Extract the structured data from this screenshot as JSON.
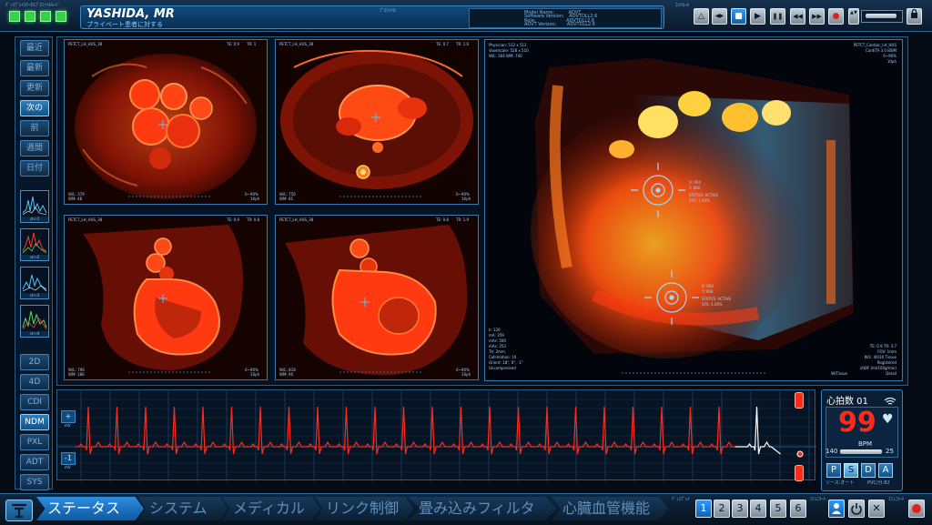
{
  "topbar": {
    "left_label": "ﾃﾞｨｽﾌﾟﾚｲｽﾃｰﾀｽﾌﾟﾛﾌｧｲﾙﾓｰﾄﾞ",
    "patient_name": "YASHIDA, MR",
    "patient_sub": "プライベート患者に対する",
    "mini_label": "ﾌﾟﾛﾌｧｲﾙ",
    "model_lines": [
      [
        "Model Name:",
        "ADVT"
      ],
      [
        "Software Version:",
        "ADVTDLL2.6"
      ],
      [
        "Role:",
        "ADVTDLL2.6"
      ],
      [
        "ADVT Version:",
        "ADVTDLL2.6"
      ]
    ],
    "control_label": "ｺﾝﾄﾛｰﾙ",
    "controls": [
      "△",
      "◀▶",
      "■",
      "▶",
      "❚❚",
      "◀◀",
      "▶▶",
      "●",
      "▲▼"
    ]
  },
  "sidebar": {
    "buttons_top": [
      "最近",
      "最新",
      "更新",
      "次の",
      "前",
      "週間",
      "日付"
    ],
    "active_top": "次の",
    "thumbs": [
      "ｽｷｬﾝ1",
      "ｽｷｬﾝ2",
      "ｽｷｬﾝ3",
      "ｽｷｬﾝ4"
    ],
    "buttons_bottom": [
      "2D",
      "4D",
      "CDI",
      "NDM",
      "PXL",
      "ADT",
      "SYS"
    ],
    "active_bottom": "NDM"
  },
  "scans": [
    {
      "title": "PETCT_LH_HUS_38",
      "te": "TE: 0.9",
      "tr": "TR: 1",
      "wl": "W/L: 379",
      "wm": "WM: 48",
      "zoom": "0~90%",
      "ph": "10ph"
    },
    {
      "title": "PETCT_LH_HUS_38",
      "te": "TE: 0.7",
      "tr": "TR: 1.6",
      "wl": "W/L: 750",
      "wm": "WM: 81",
      "zoom": "0~90%",
      "ph": "10ph"
    },
    {
      "title": "PETCT_LH_HUS_38",
      "te": "TE: 0.9",
      "tr": "TR: 0.8",
      "wl": "W/L: 796",
      "wm": "WM: 186",
      "zoom": "0~90%",
      "ph": "10ph"
    },
    {
      "title": "PETCT_LH_HUS_38",
      "te": "TE: 0.8",
      "tr": "TR: 1.9",
      "wl": "W/L: 818",
      "wm": "WM: 90",
      "zoom": "0~90%",
      "ph": "10ph"
    }
  ],
  "volume": {
    "top_left": [
      "Physician: 512 x 512",
      "Voxelscale: 528 x 510",
      "W/L: 304  WM: 740"
    ],
    "top_right": [
      "PETCT_Cardiac_LH_HUS",
      "CardiTA 3.0 BSIM",
      "0~90%",
      "10ph"
    ],
    "bottom_left": [
      "k: 120",
      "mA: 359",
      "mAs: 500",
      "mAs: 253",
      "Th: 2mm",
      "Collimation: 10",
      "Orient: 18°, 0°, -1°",
      "Uncompressed"
    ],
    "bottom_right": [
      "TE: 0.9  TR: 3.7",
      "FOV: 1mm",
      "W/L: 40/30 Tissue",
      "Registered",
      "zOBF (ml/100g/min)",
      "Detail",
      "W/Tissue"
    ],
    "target1": [
      "X: 950",
      "Y: 880",
      "STATUS: ACTIVE",
      "SYS: 1.00%"
    ],
    "target2": [
      "X: 840",
      "Y: 908",
      "STATUS: ACTIVE",
      "SYS: 1.00%"
    ]
  },
  "ekg": {
    "top_btn": "+",
    "top_unit": "mV",
    "bottom_btn": "-1",
    "bottom_unit": "mV"
  },
  "heart": {
    "title": "心拍数 01",
    "value": "99",
    "unit": "BPM",
    "range_min": "140",
    "range_max": "25",
    "letters": [
      "P",
      "S",
      "D",
      "A"
    ],
    "footer_left": "ソース:オート",
    "footer_right": "PVC/分:82",
    "color": "#ff2a1a"
  },
  "tabs": [
    "ステータス",
    "システム",
    "メディカル",
    "リンク制御",
    "畳み込みフィルタ",
    "心臓血管機能"
  ],
  "active_tab": "ステータス",
  "bottom_right": {
    "label1": "ﾃﾞｨｽﾌﾟﾚｲ",
    "numbers": [
      "1",
      "2",
      "3",
      "4",
      "5",
      "6"
    ],
    "label2": "ｺﾐｭﾆｹｰﾄ",
    "label3": "ｺﾐｭﾆｹｰﾄ"
  },
  "colors": {
    "accent": "#2e8de0",
    "scan_red": "#ff3a10",
    "grid": "#1d4d7d",
    "trace": "#ff2a1a"
  }
}
